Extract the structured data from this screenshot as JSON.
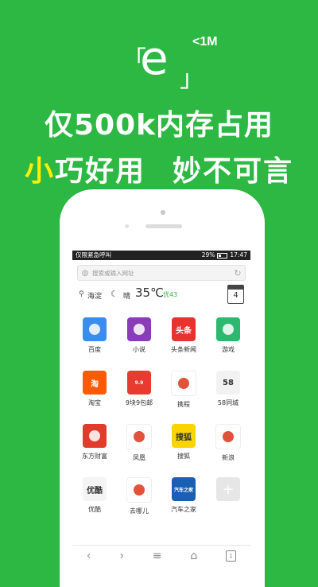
{
  "colors": {
    "background": "#2db843",
    "accent_yellow": "#ffee00"
  },
  "logo": {
    "bracket_left": "「",
    "letter": "e",
    "bracket_right": "」",
    "size_note": "<1M"
  },
  "headline": {
    "line1": "仅500k内存占用",
    "line2_highlight": "小",
    "line2_rest": "巧好用",
    "line2_second": "妙不可言"
  },
  "status_bar": {
    "left_text": "仅限紧急呼叫",
    "battery_text": "29%",
    "time": "17:47"
  },
  "search": {
    "placeholder": "搜索或输入网址",
    "globe_icon": "globe-icon",
    "reload_icon": "reload-icon"
  },
  "weather": {
    "city": "海淀",
    "condition": "晴",
    "temperature": "35℃",
    "air_quality": "优43",
    "calendar_day": "4"
  },
  "apps": [
    {
      "label": "百度",
      "icon": "baidu-icon",
      "color": "#3b8cf0",
      "glyph": ""
    },
    {
      "label": "小说",
      "icon": "book-icon",
      "color": "#8a3cb8",
      "glyph": ""
    },
    {
      "label": "头条新闻",
      "icon": "toutiao-icon",
      "color": "#e8322d",
      "glyph": "头条"
    },
    {
      "label": "游戏",
      "icon": "gamepad-icon",
      "color": "#2db86f",
      "glyph": ""
    },
    {
      "label": "淘宝",
      "icon": "taobao-icon",
      "color": "#ff5a00",
      "glyph": "淘"
    },
    {
      "label": "9块9包邮",
      "icon": "jiukuaijiu-icon",
      "color": "#e63b2e",
      "glyph": "9.9"
    },
    {
      "label": "携程",
      "icon": "ctrip-icon",
      "color": "#ffffff",
      "glyph": ""
    },
    {
      "label": "58同城",
      "icon": "58-icon",
      "color": "#f2f2f2",
      "glyph": "58"
    },
    {
      "label": "东方财富",
      "icon": "eastmoney-icon",
      "color": "#e23b2b",
      "glyph": ""
    },
    {
      "label": "凤凰",
      "icon": "ifeng-icon",
      "color": "#ffffff",
      "glyph": ""
    },
    {
      "label": "搜狐",
      "icon": "sohu-icon",
      "color": "#f9d400",
      "glyph": "搜狐"
    },
    {
      "label": "新浪",
      "icon": "sina-weibo-icon",
      "color": "#ffffff",
      "glyph": ""
    },
    {
      "label": "优酷",
      "icon": "youku-icon",
      "color": "#f4f4f4",
      "glyph": "优酷"
    },
    {
      "label": "去哪儿",
      "icon": "qunar-icon",
      "color": "#ffffff",
      "glyph": ""
    },
    {
      "label": "汽车之家",
      "icon": "autohome-icon",
      "color": "#1a5fb4",
      "glyph": "汽车之家"
    },
    {
      "label": "",
      "icon": "add-icon",
      "color": "#e6e6e6",
      "glyph": "+"
    }
  ],
  "nav": {
    "back_icon": "back-icon",
    "forward_icon": "forward-icon",
    "menu_icon": "menu-icon",
    "home_icon": "home-icon",
    "tabs_icon": "tabs-icon",
    "tabs_count": "1"
  }
}
